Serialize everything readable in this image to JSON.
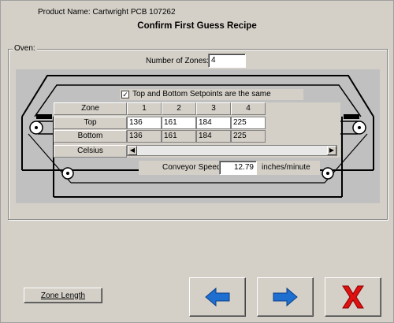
{
  "header": {
    "product_name": "Product Name:  Cartwright PCB 107262",
    "title": "Confirm First Guess Recipe"
  },
  "oven": {
    "group_label": "Oven:",
    "zones_label": "Number of Zones:",
    "zones_value": "4",
    "same_setpoints_label": "Top and Bottom Setpoints are the same",
    "same_setpoints_checked": true,
    "grid": {
      "zone_header": "Zone",
      "zone_numbers": [
        "1",
        "2",
        "3",
        "4"
      ],
      "rows": [
        {
          "label": "Top",
          "values": [
            "136",
            "161",
            "184",
            "225"
          ]
        },
        {
          "label": "Bottom",
          "values": [
            "136",
            "161",
            "184",
            "225"
          ]
        }
      ],
      "units_label": "Celsius"
    },
    "conveyor_label": "Conveyor Speed:",
    "conveyor_value": "12.79",
    "conveyor_unit": "inches/minute"
  },
  "buttons": {
    "zone_length": "Zone Length",
    "back_icon": "left-arrow-icon",
    "next_icon": "right-arrow-icon",
    "cancel_icon": "red-x-icon"
  },
  "colors": {
    "window_bg": "#d4d0c8",
    "arrow_blue": "#1f6fd1",
    "cancel_red": "#e01010"
  }
}
